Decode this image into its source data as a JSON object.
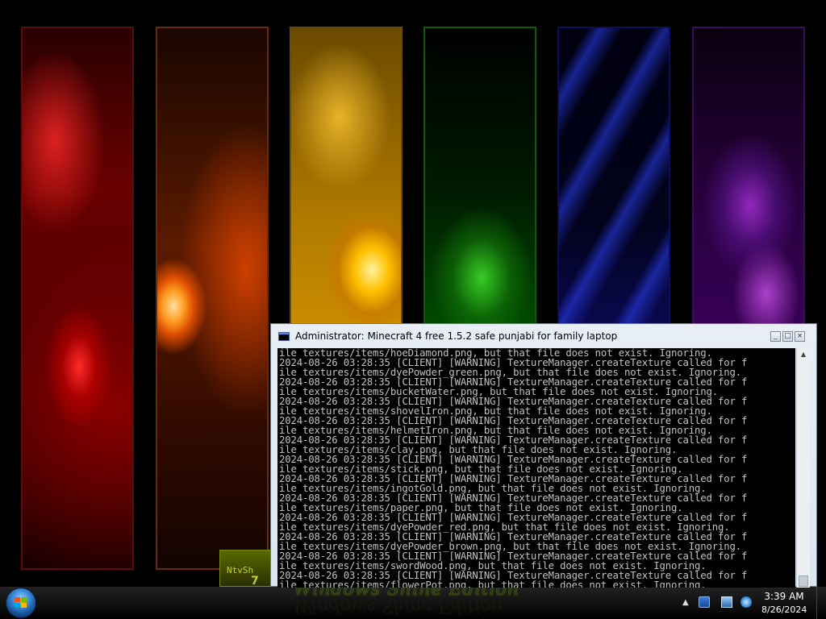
{
  "desktop": {
    "panels": [
      "red",
      "orange",
      "yellow",
      "green",
      "blue",
      "purple"
    ],
    "desktop_icon": {
      "label": "NtvSh",
      "number": "7"
    },
    "edition_text": "Windows Shine Edition"
  },
  "console": {
    "title": "Administrator:  Minecraft 4 free 1.5.2 safe punjabi for family laptop",
    "icon": "console-icon",
    "lines": [
      "ile textures/items/hoeDiamond.png, but that file does not exist. Ignoring.",
      "2024-08-26 03:28:35 [CLIENT] [WARNING] TextureManager.createTexture called for f",
      "ile textures/items/dyePowder_green.png, but that file does not exist. Ignoring.",
      "2024-08-26 03:28:35 [CLIENT] [WARNING] TextureManager.createTexture called for f",
      "ile textures/items/bucketWater.png, but that file does not exist. Ignoring.",
      "2024-08-26 03:28:35 [CLIENT] [WARNING] TextureManager.createTexture called for f",
      "ile textures/items/shovelIron.png, but that file does not exist. Ignoring.",
      "2024-08-26 03:28:35 [CLIENT] [WARNING] TextureManager.createTexture called for f",
      "ile textures/items/helmetIron.png, but that file does not exist. Ignoring.",
      "2024-08-26 03:28:35 [CLIENT] [WARNING] TextureManager.createTexture called for f",
      "ile textures/items/clay.png, but that file does not exist. Ignoring.",
      "2024-08-26 03:28:35 [CLIENT] [WARNING] TextureManager.createTexture called for f",
      "ile textures/items/stick.png, but that file does not exist. Ignoring.",
      "2024-08-26 03:28:35 [CLIENT] [WARNING] TextureManager.createTexture called for f",
      "ile textures/items/ingotGold.png, but that file does not exist. Ignoring.",
      "2024-08-26 03:28:35 [CLIENT] [WARNING] TextureManager.createTexture called for f",
      "ile textures/items/paper.png, but that file does not exist. Ignoring.",
      "2024-08-26 03:28:35 [CLIENT] [WARNING] TextureManager.createTexture called for f",
      "ile textures/items/dyePowder_red.png, but that file does not exist. Ignoring.",
      "2024-08-26 03:28:35 [CLIENT] [WARNING] TextureManager.createTexture called for f",
      "ile textures/items/dyePowder_brown.png, but that file does not exist. Ignoring.",
      "2024-08-26 03:28:35 [CLIENT] [WARNING] TextureManager.createTexture called for f",
      "ile textures/items/swordWood.png, but that file does not exist. Ignoring.",
      "2024-08-26 03:28:35 [CLIENT] [WARNING] TextureManager.createTexture called for f",
      "ile textures/items/flowerPot.png, but that file does not exist. Ignoring."
    ],
    "controls": {
      "minimize": "minimize-icon",
      "maximize": "maximize-icon",
      "close": "close-icon"
    }
  },
  "taskbar": {
    "start_icon": "windows-logo-icon",
    "tray": {
      "chevron": "▲",
      "icons": [
        "flag-icon",
        "network-icon",
        "volume-icon"
      ],
      "time": "3:39 AM",
      "date": "8/26/2024"
    }
  },
  "colors": {
    "console_bg": "#000000",
    "console_text": "#c0c0c0",
    "title_bar": "#dbe5f1"
  }
}
